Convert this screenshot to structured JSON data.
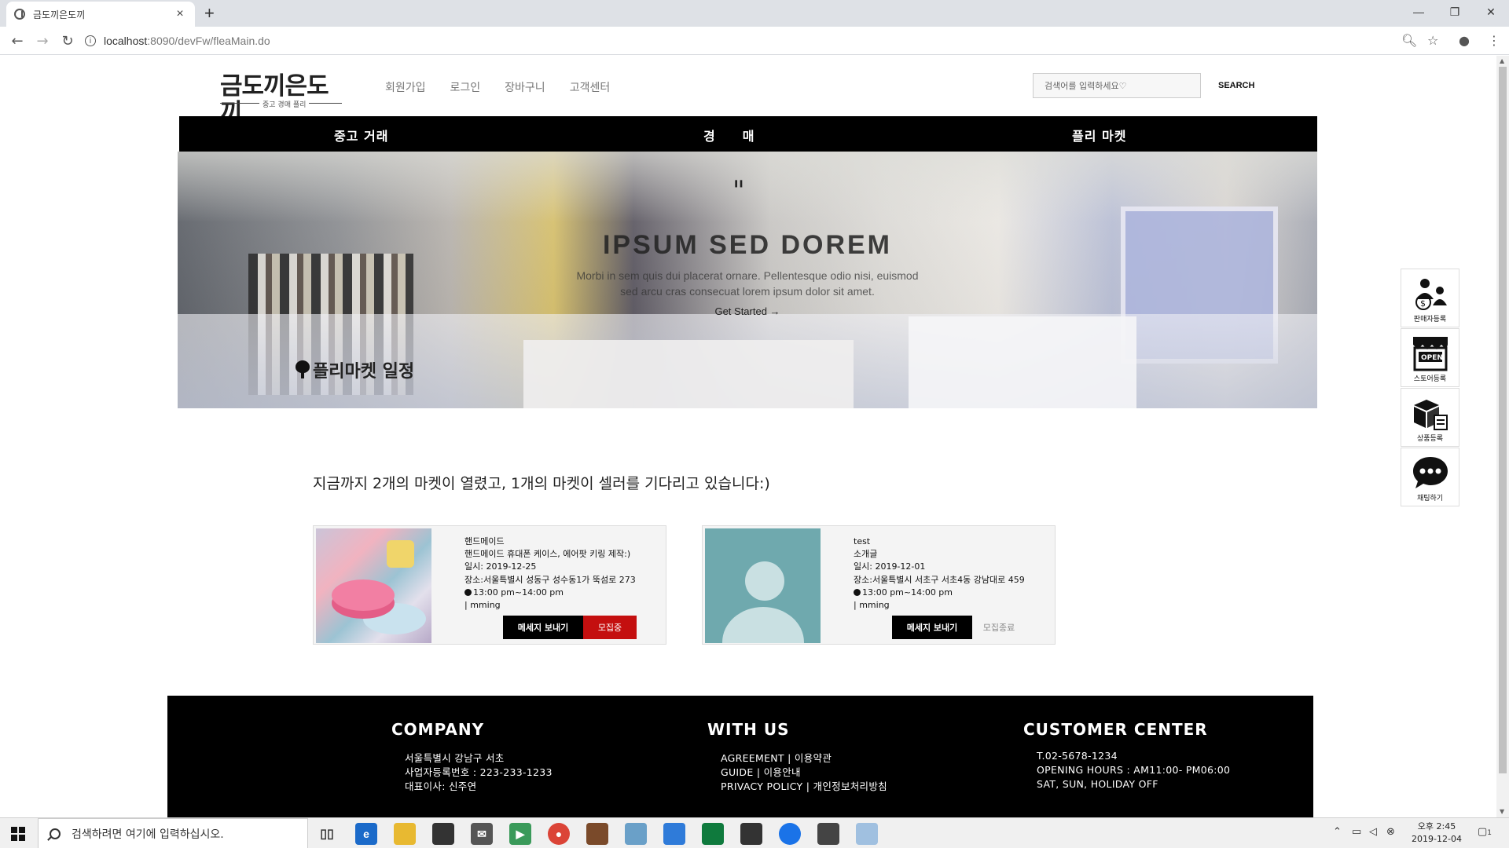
{
  "browser": {
    "tab_title": "금도끼은도끼",
    "tab_close": "×",
    "new_tab": "+",
    "url_host": "localhost",
    "url_rest": ":8090/devFw/fleaMain.do",
    "win_min": "—",
    "win_max": "❐",
    "win_close": "✕"
  },
  "site": {
    "logo_text": "금도끼은도끼",
    "logo_sub": "중고 경매 플리",
    "top_menu": [
      "회원가입",
      "로그인",
      "장바구니",
      "고객센터"
    ],
    "search_placeholder": "검색어를 입력하세요♡",
    "search_button": "SEARCH",
    "main_nav": [
      "중고 거래",
      "경　　매",
      "플리 마켓"
    ]
  },
  "hero": {
    "quote": "\"",
    "title": "IPSUM SED DOREM",
    "text_line1": "Morbi in sem quis dui placerat ornare. Pellentesque odio nisi, euismod",
    "text_line2": "sed arcu cras consecuat lorem ipsum dolor sit amet.",
    "cta": "Get Started →"
  },
  "schedule": {
    "title": "플리마켓 일정",
    "subtitle": "지금까지 2개의 마켓이 열렸고, 1개의 마켓이 셀러를 기다리고 있습니다:)"
  },
  "markets": [
    {
      "name": "핸드메이드",
      "desc": "핸드메이드 휴대폰 케이스, 에어팟 키링 제작:)",
      "date": "일시: 2019-12-25",
      "place": "장소:서울특별시 성동구 성수동1가 뚝섬로 273",
      "time": "13:00 pm~14:00 pm",
      "host": "| mming",
      "msg_button": "메세지 보내기",
      "status": "모집중"
    },
    {
      "name": "test",
      "desc": "소개글",
      "date": "일시: 2019-12-01",
      "place": "장소:서울특별시 서초구 서초4동 강남대로 459",
      "time": "13:00 pm~14:00 pm",
      "host": "| mming",
      "msg_button": "메세지 보내기",
      "status": "모집종료"
    }
  ],
  "footer": {
    "company": {
      "title": "COMPANY",
      "lines": [
        "서울특별시 강남구 서초",
        "사업자등록번호 : 223-233-1233",
        "대표이사: 신주연"
      ]
    },
    "withus": {
      "title": "WITH US",
      "lines": [
        "AGREEMENT | 이용약관",
        "GUIDE | 이용안내",
        "PRIVACY POLICY | 개인정보처리방침"
      ]
    },
    "customer": {
      "title": "CUSTOMER CENTER",
      "lines": [
        "T.02-5678-1234",
        "OPENING HOURS : AM11:00- PM06:00",
        "SAT, SUN, HOLIDAY OFF"
      ]
    }
  },
  "side_widgets": [
    "판매자등록",
    "스토어등록",
    "상품등록",
    "채팅하기"
  ],
  "side_open_sign": "OPEN",
  "taskbar": {
    "search_placeholder": "검색하려면 여기에 입력하십시오.",
    "clock_time": "오후 2:45",
    "clock_date": "2019-12-04",
    "notification_count": "1"
  },
  "colors": {
    "accent_red": "#c40f0f",
    "nav_black": "#000000",
    "avatar_teal": "#6fa9ae"
  }
}
